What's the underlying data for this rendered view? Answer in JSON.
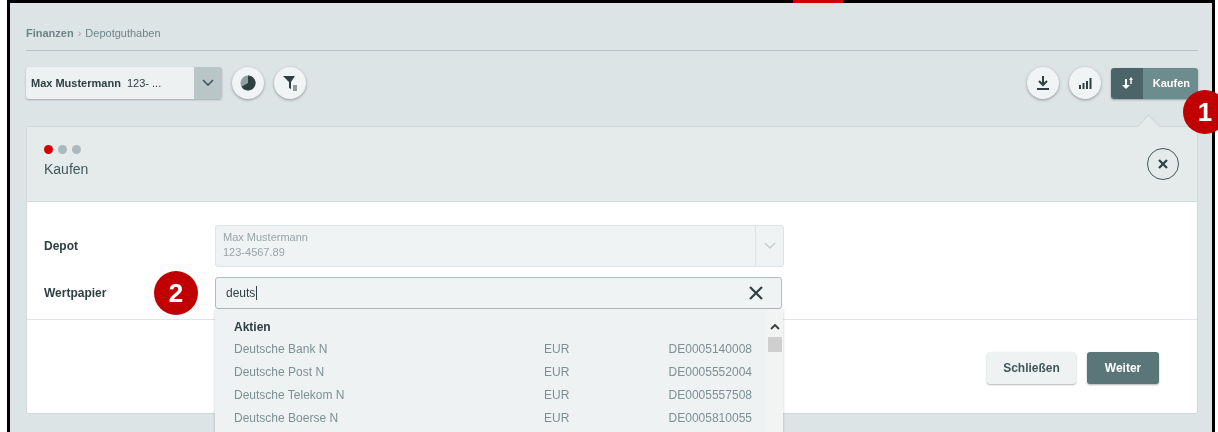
{
  "breadcrumb": [
    {
      "label": "Finanzen",
      "current": false
    },
    {
      "label": "Depotguthaben",
      "current": true
    }
  ],
  "breadcrumb_separator": "›",
  "account_select": {
    "name": "Max Mustermann",
    "number": "123- ..."
  },
  "action_button": {
    "label": "Kaufen"
  },
  "callouts": [
    "1",
    "2"
  ],
  "panel": {
    "steps": [
      {
        "selected": true
      },
      {
        "selected": false
      },
      {
        "selected": false
      }
    ],
    "title": "Kaufen"
  },
  "form": [
    {
      "label": "Depot",
      "kind": "select",
      "disabled": true,
      "line1": "Max Mustermann",
      "line2": "123-4567.89"
    },
    {
      "label": "Wertpapier",
      "kind": "search",
      "disabled": false,
      "value": "deuts"
    }
  ],
  "results": {
    "group": "Aktien",
    "rows": [
      {
        "name": "Deutsche Bank N",
        "currency": "EUR",
        "isin": "DE0005140008"
      },
      {
        "name": "Deutsche Post N",
        "currency": "EUR",
        "isin": "DE0005552004"
      },
      {
        "name": "Deutsche Telekom N",
        "currency": "EUR",
        "isin": "DE0005557508"
      },
      {
        "name": "Deutsche Boerse N",
        "currency": "EUR",
        "isin": "DE0005810055"
      }
    ]
  },
  "buttons": [
    "Schließen",
    "Weiter"
  ]
}
